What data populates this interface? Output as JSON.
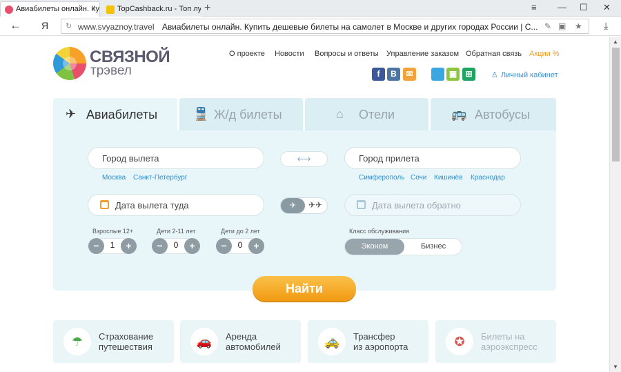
{
  "browser": {
    "tabs": [
      {
        "title": "Авиабилеты онлайн. Куп",
        "favicon_color": "#e94e6b"
      },
      {
        "title": "TopCashback.ru - Топ лучш",
        "favicon_color": "#f3c200"
      }
    ],
    "new_tab": "+",
    "window": {
      "menu": "≡",
      "minimize": "—",
      "maximize": "☐",
      "close": "✕"
    },
    "back": "←",
    "ya": "Я",
    "url_domain": "www.svyaznoy.travel",
    "url_title": "Авиабилеты онлайн. Купить дешевые билеты на самолет в Москве и других городах России | С...",
    "download": "⤓"
  },
  "logo": {
    "top": "СВЯЗНОЙ",
    "bottom": "трэвел"
  },
  "topnav": [
    "О проекте",
    "Новости",
    "Вопросы и ответы",
    "Управление заказом",
    "Обратная связь",
    "Акции %"
  ],
  "social": [
    {
      "label": "f",
      "color": "#3b5998"
    },
    {
      "label": "В",
      "color": "#4c75a3"
    },
    {
      "label": "✉",
      "color": "#f2a33a"
    },
    {
      "label": "",
      "color": "#3aa7e0"
    },
    {
      "label": "▣",
      "color": "#8cc63f"
    },
    {
      "label": "⊞",
      "color": "#1fa463"
    }
  ],
  "cabinet": "Личный кабинет",
  "search_tabs": [
    {
      "label": "Авиабилеты",
      "icon": "✈"
    },
    {
      "label": "Ж/д билеты",
      "icon": "🚆"
    },
    {
      "label": "Отели",
      "icon": "⌂"
    },
    {
      "label": "Автобусы",
      "icon": "🚌"
    }
  ],
  "form": {
    "from_placeholder": "Город вылета",
    "to_placeholder": "Город прилета",
    "from_quick": [
      "Москва",
      "Санкт-Петербург"
    ],
    "to_quick": [
      "Симферополь",
      "Сочи",
      "Кишинёв",
      "Краснодар"
    ],
    "swap": "⟷",
    "depart_placeholder": "Дата вылета туда",
    "return_placeholder": "Дата вылета обратно",
    "trip_oneway": "✈",
    "trip_round": "✈✈",
    "adults_label": "Взрослые 12+",
    "children_label": "Дети 2-11 лет",
    "infants_label": "Дети до 2 лет",
    "adults": "1",
    "children": "0",
    "infants": "0",
    "minus": "−",
    "plus": "+",
    "class_label": "Класс обслуживания",
    "class_economy": "Эконом",
    "class_business": "Бизнес",
    "find_button": "Найти"
  },
  "services": [
    {
      "title": "Страхование\nпутешествия",
      "icon": "☂",
      "color": "#4aa84a"
    },
    {
      "title": "Аренда\nавтомобилей",
      "icon": "🚗",
      "color": "#8a7ab8"
    },
    {
      "title": "Трансфер\nиз аэропорта",
      "icon": "🚕",
      "color": "#555"
    },
    {
      "title": "Билеты на\nаэроэкспресс",
      "icon": "✪",
      "color": "#d9534f"
    }
  ]
}
